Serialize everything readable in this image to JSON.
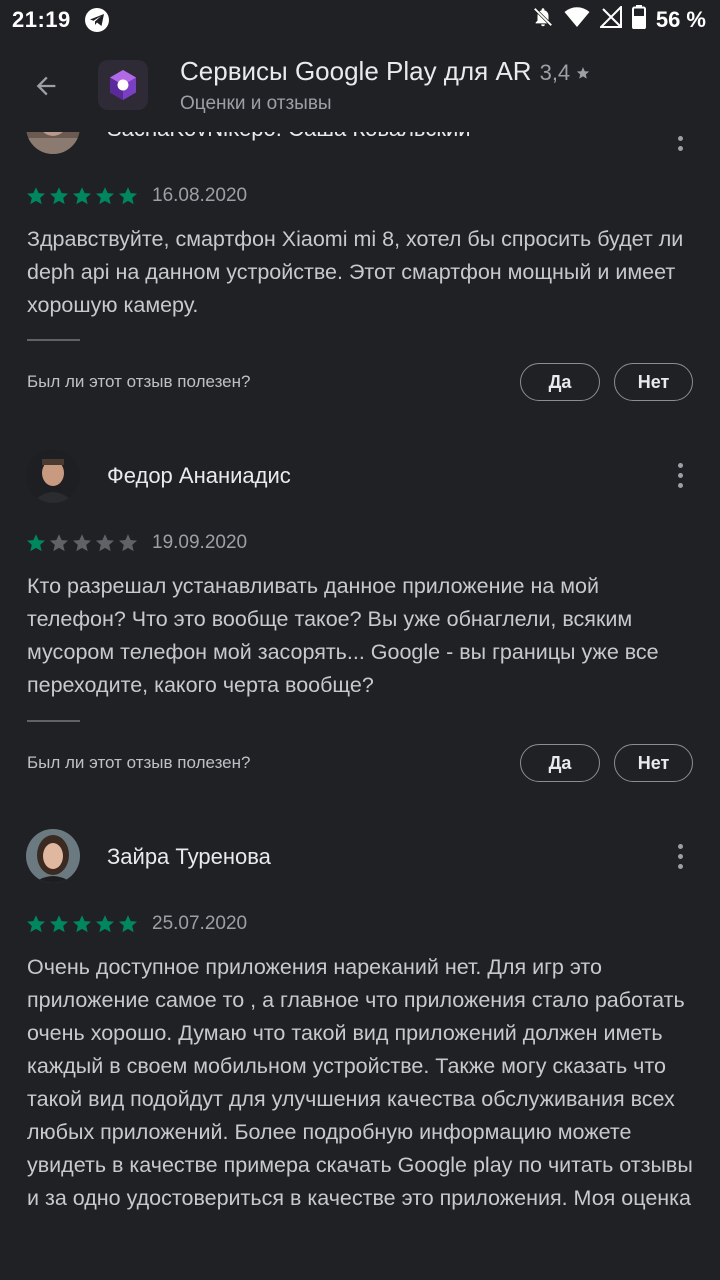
{
  "status_bar": {
    "time": "21:19",
    "battery": "56 %"
  },
  "app_bar": {
    "title": "Сервисы Google Play для AR",
    "rating": "3,4",
    "subtitle": "Оценки и отзывы"
  },
  "accent_color": "#01875f",
  "reviews": [
    {
      "author": "SachaKovNikepo. Саша Ковальский",
      "stars": 5,
      "date": "16.08.2020",
      "text": "Здравствуйте, смартфон Xiaomi mi 8, хотел бы спросить будет ли deph api на данном устройстве. Этот смартфон мощный и имеет хорошую камеру.",
      "helpful_question": "Был ли этот отзыв полезен?",
      "yes_label": "Да",
      "no_label": "Нет"
    },
    {
      "author": "Федор Ананиадис",
      "stars": 1,
      "date": "19.09.2020",
      "text": "Кто разрешал устанавливать данное приложение на мой телефон? Что это вообще такое? Вы уже обнаглели, всяким мусором телефон мой засорять... Google - вы границы уже все переходите, какого черта вообще?",
      "helpful_question": "Был ли этот отзыв полезен?",
      "yes_label": "Да",
      "no_label": "Нет"
    },
    {
      "author": "Зайра Туренова",
      "stars": 5,
      "date": "25.07.2020",
      "text": "Очень доступное приложения нареканий нет. Для игр это приложение самое то , а главное что приложения стало работать очень хорошо. Думаю что такой вид приложений должен иметь каждый в своем мобильном устройстве. Также могу сказать что такой вид подойдут для улучшения качества обслуживания всех любых приложений. Более подробную информацию можете увидеть в качестве примера скачать Google play по читать отзывы и за одно удостовериться в качестве это приложения. Моя оценка"
    }
  ]
}
